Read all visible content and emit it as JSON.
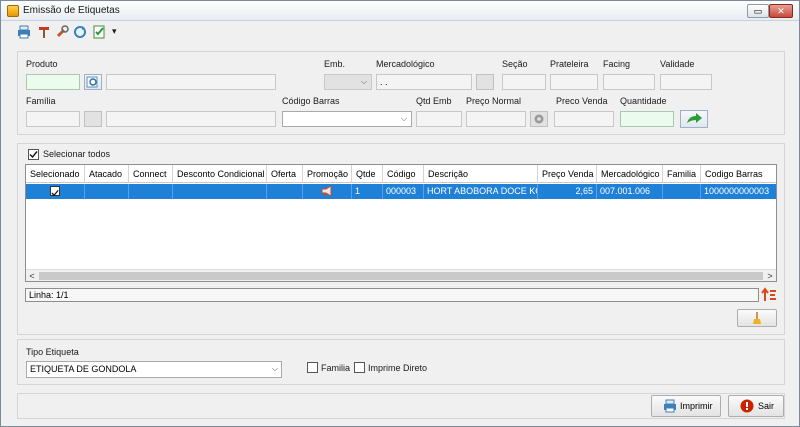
{
  "window": {
    "title": "Emissão de Etiquetas",
    "min_glyph": "▭",
    "close_glyph": "✕"
  },
  "toolbar": {
    "icons": [
      "print-icon",
      "hammer-icon",
      "wrench-icon",
      "refresh-icon",
      "checklist-icon"
    ],
    "dropdown_glyph": "▾"
  },
  "filters": {
    "produto_label": "Produto",
    "emb_label": "Emb.",
    "mercadologico_label": "Mercadológico",
    "mercadologico_value": ". .",
    "secao_label": "Seção",
    "prateleira_label": "Prateleira",
    "facing_label": "Facing",
    "validade_label": "Validade",
    "familia_label": "Família",
    "codigo_barras_label": "Código Barras",
    "qtd_emb_label": "Qtd Emb",
    "preco_normal_label": "Preço Normal",
    "preco_venda_label": "Preco Venda",
    "quantidade_label": "Quantidade"
  },
  "grid": {
    "select_all_label": "Selecionar todos",
    "columns": [
      "Selecionado",
      "Atacado",
      "Connect",
      "Desconto Condicional",
      "Oferta",
      "Promoção",
      "Qtde",
      "Código",
      "Descrição",
      "Preço Venda",
      "Mercadológico",
      "Familia",
      "Codigo Barras"
    ],
    "rows": [
      {
        "selecionado": true,
        "atacado": "",
        "connect": "",
        "desconto": "",
        "oferta": "",
        "promocao": "megaphone-icon",
        "qtde": "1",
        "codigo": "000003",
        "descricao": "HORT ABOBORA DOCE KG",
        "preco_venda": "2,65",
        "mercadologico": "007.001.006",
        "familia": "",
        "codigo_barras": "1000000000003"
      }
    ],
    "status": "Linha: 1/1",
    "scroll_left": "<",
    "scroll_right": ">"
  },
  "tipo": {
    "label": "Tipo Etiqueta",
    "value": "ETIQUETA DE GONDOLA",
    "familia_label": "Familia",
    "imprime_label": "Imprime Direto"
  },
  "buttons": {
    "imprimir": "Imprimir",
    "sair": "Sair"
  },
  "colors": {
    "selection": "#1f80d8",
    "close": "#cc2200",
    "go": "#2a9a3a"
  }
}
